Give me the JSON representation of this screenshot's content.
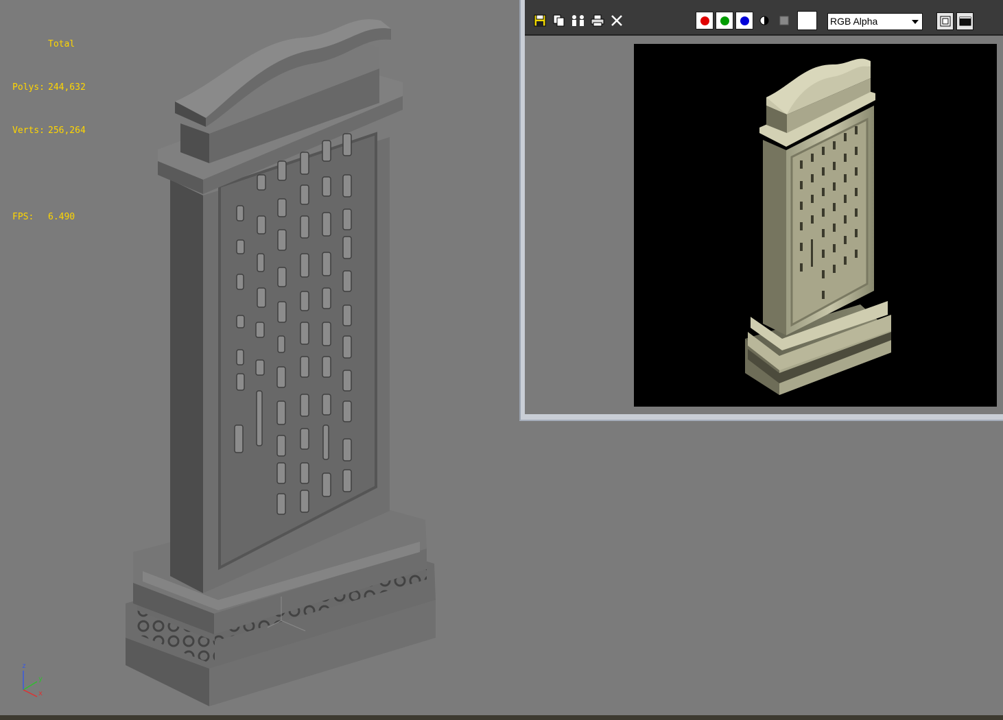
{
  "viewport": {
    "stats": {
      "header": "Total",
      "polys_label": "Polys:",
      "polys_value": "244,632",
      "verts_label": "Verts:",
      "verts_value": "256,264",
      "fps_label": "FPS:",
      "fps_value": "6.490"
    },
    "axis_labels": {
      "z": "z",
      "y": "y",
      "x": "x"
    }
  },
  "render_window": {
    "channel_select": {
      "value": "RGB Alpha"
    },
    "icons": [
      "save-icon",
      "clone-icon",
      "people-icon",
      "print-icon",
      "clear-x-icon",
      "red-channel-icon",
      "green-channel-icon",
      "blue-channel-icon",
      "mono-icon",
      "alpha-icon",
      "swatch",
      "frame-icon",
      "display-icon"
    ],
    "colors": {
      "red": "#e00000",
      "green": "#009c00",
      "blue": "#0000d8",
      "toolbar": "#3a3a3a",
      "frame": "#c9ced6"
    }
  },
  "colors": {
    "viewport_bg": "#7b7b7b",
    "stats_text": "#ffd600",
    "render_bg": "#000000"
  }
}
